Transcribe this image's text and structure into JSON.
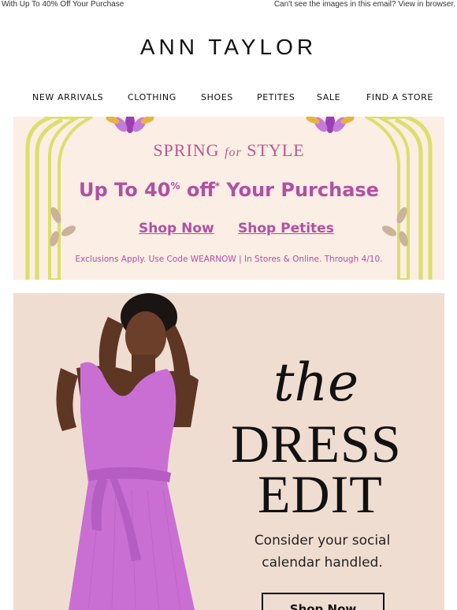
{
  "preheader": {
    "left_text": "With Up To 40% Off Your Purchase",
    "right_text": "Can't see the images in this email? View in browser."
  },
  "brand": {
    "logo_text": "ANN TAYLOR"
  },
  "nav": {
    "items": [
      {
        "label": "NEW ARRIVALS"
      },
      {
        "label": "CLOTHING"
      },
      {
        "label": "SHOES"
      },
      {
        "label": "PETITES"
      },
      {
        "label": "SALE"
      },
      {
        "label": "FIND A STORE"
      }
    ]
  },
  "promo_banner": {
    "title_left": "SPRING",
    "title_script": "for",
    "title_right": "STYLE",
    "headline_pre": "Up To 40",
    "headline_pct": "%",
    "headline_off": " off",
    "headline_mark": "*",
    "headline_post": " Your Purchase",
    "links": [
      {
        "label": "Shop Now"
      },
      {
        "label": "Shop Petites"
      }
    ],
    "fine_print": "Exclusions Apply. Use Code WEARNOW | In Stores & Online. Through 4/10.",
    "colors": {
      "background": "#fbeee4",
      "accent": "#b24fa3",
      "arch": "#dcdf6a"
    }
  },
  "hero": {
    "script_word": "the",
    "title_line1": "DRESS",
    "title_line2": "EDIT",
    "subtitle_line1": "Consider your social",
    "subtitle_line2": "calendar handled.",
    "cta_label": "Shop Now",
    "colors": {
      "background": "#f0ddd1",
      "dress": "#c96fd4"
    }
  }
}
